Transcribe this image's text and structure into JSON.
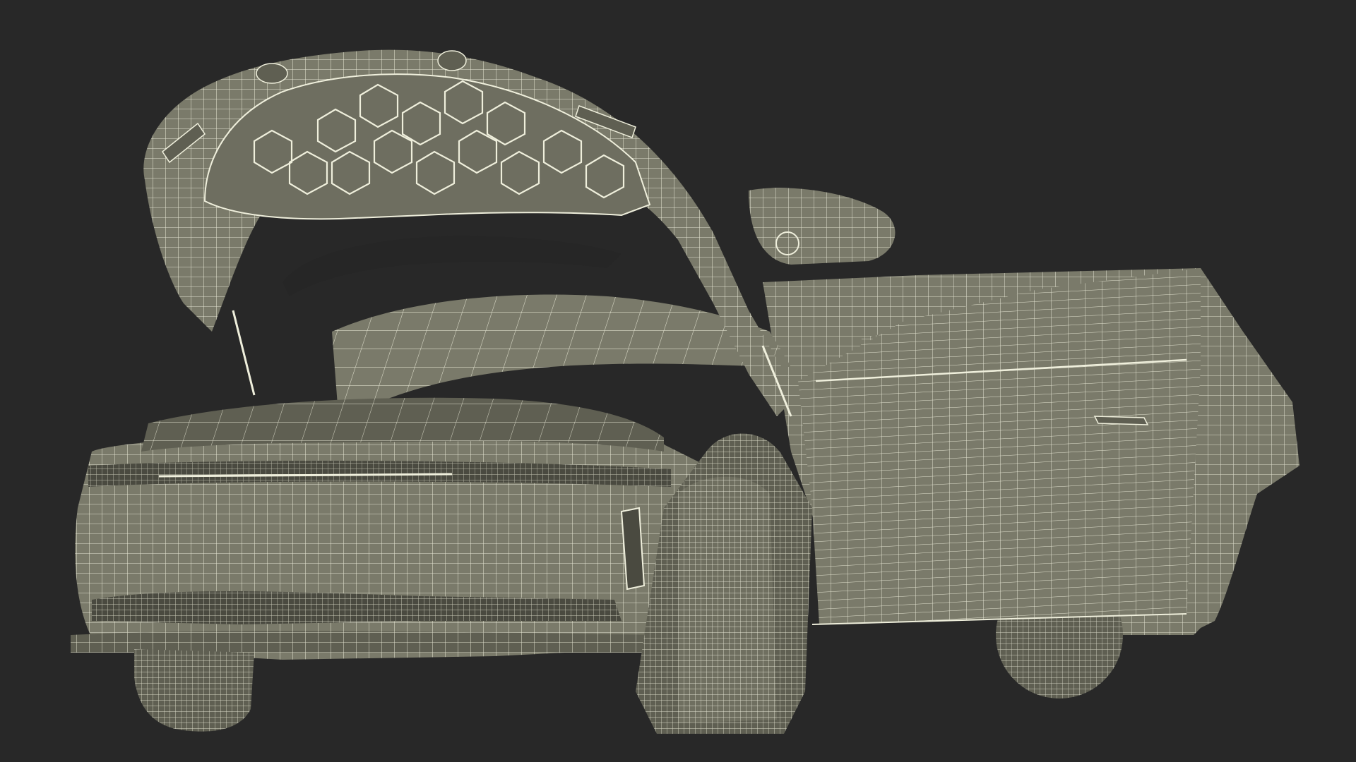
{
  "scene": {
    "subject": "wireframe-car-open-hood-door",
    "background_color": "#282828",
    "surface_color": "#7a7a6a",
    "surface_shade_color": "#5f5f52",
    "surface_dark_color": "#4a4a40",
    "wire_color": "#efefdc",
    "cavity_color": "#262626"
  }
}
